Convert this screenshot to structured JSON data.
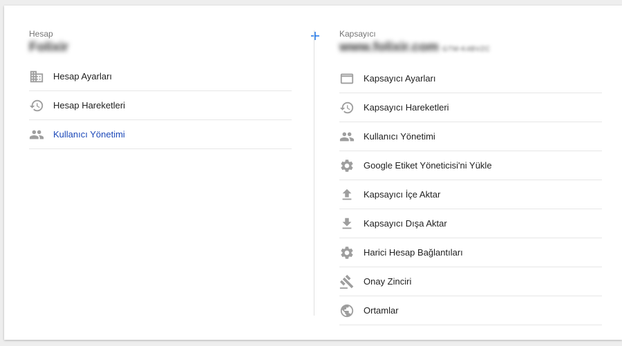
{
  "colors": {
    "accent_blue": "#1a73e8",
    "active_link": "#1a47b8",
    "icon_gray": "#9e9e9e",
    "text": "#212121",
    "muted": "#757575"
  },
  "account": {
    "section_label": "Hesap",
    "name": "Folixir",
    "add_icon": "plus-icon",
    "items": [
      {
        "label": "Hesap Ayarları",
        "icon": "building-icon"
      },
      {
        "label": "Hesap Hareketleri",
        "icon": "history-icon"
      },
      {
        "label": "Kullanıcı Yönetimi",
        "icon": "people-icon",
        "active": true
      }
    ]
  },
  "container": {
    "section_label": "Kapsayıcı",
    "name": "www.folixir.com",
    "container_id": "GTM-K4BVZC",
    "items": [
      {
        "label": "Kapsayıcı Ayarları",
        "icon": "web-window-icon"
      },
      {
        "label": "Kapsayıcı Hareketleri",
        "icon": "history-icon"
      },
      {
        "label": "Kullanıcı Yönetimi",
        "icon": "people-icon"
      },
      {
        "label": "Google Etiket Yöneticisi'ni Yükle",
        "icon": "gear-icon"
      },
      {
        "label": "Kapsayıcı İçe Aktar",
        "icon": "upload-icon"
      },
      {
        "label": "Kapsayıcı Dışa Aktar",
        "icon": "download-icon"
      },
      {
        "label": "Harici Hesap Bağlantıları",
        "icon": "gear-icon"
      },
      {
        "label": "Onay Zinciri",
        "icon": "gavel-icon"
      },
      {
        "label": "Ortamlar",
        "icon": "globe-icon"
      }
    ]
  }
}
